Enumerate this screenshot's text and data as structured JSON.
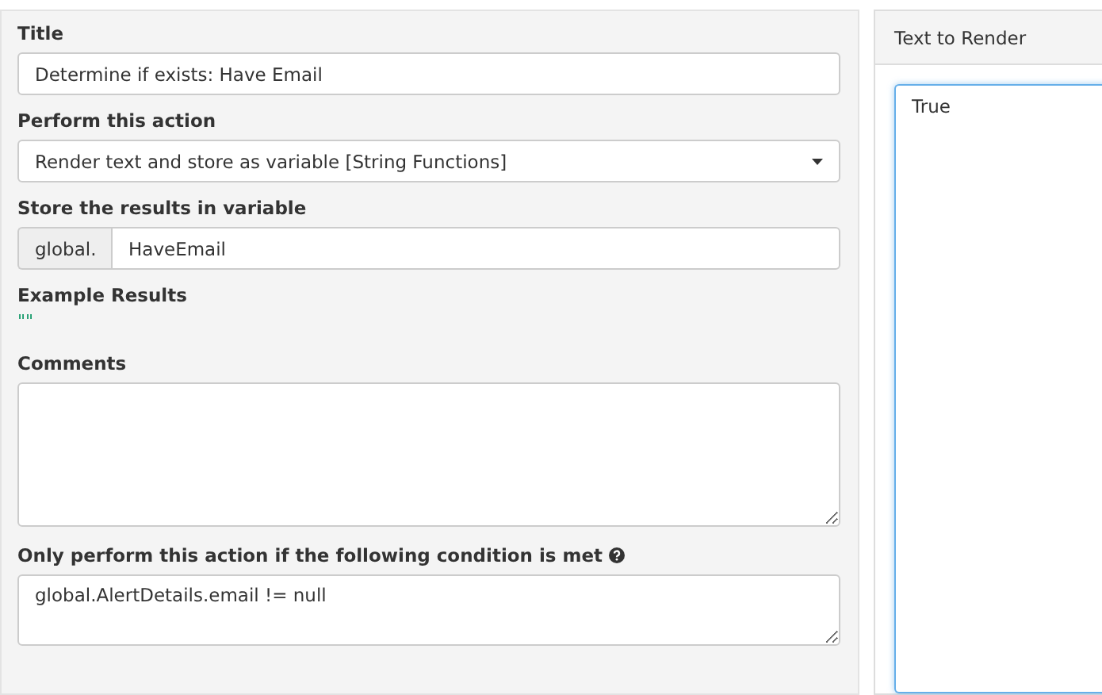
{
  "form": {
    "title": {
      "label": "Title",
      "value": "Determine if exists: Have Email"
    },
    "action": {
      "label": "Perform this action",
      "value": "Render text and store as variable [String Functions]"
    },
    "variable": {
      "label": "Store the results in variable",
      "prefix": "global.",
      "value": "HaveEmail"
    },
    "example": {
      "label": "Example Results",
      "value": "\"\""
    },
    "comments": {
      "label": "Comments"
    },
    "condition": {
      "label": "Only perform this action if the following condition is met",
      "value": "global.AlertDetails.email != null"
    }
  },
  "render_panel": {
    "title": "Text to Render",
    "value": "True",
    "focused": true
  }
}
